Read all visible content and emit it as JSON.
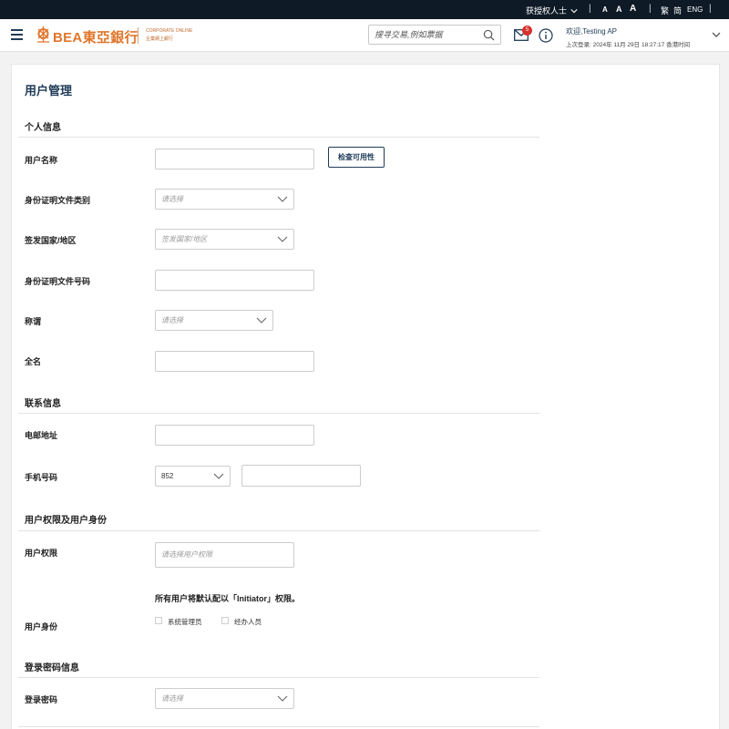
{
  "topbar": {
    "authorized_person": "获授权人士",
    "font_sizes": [
      "A",
      "A",
      "A"
    ],
    "lang_trad": "繁",
    "lang_simp": "简",
    "lang_eng": "ENG"
  },
  "header": {
    "logo_text": "BEA東亞銀行",
    "logo_sub_en": "CORPORATE ONLINE",
    "logo_sub_cn": "企業網上銀行",
    "search_placeholder": "搜寻交易,例如票据",
    "mail_badge": "5",
    "welcome": "欢迎,Testing AP",
    "last_login": "上次登录: 2024年 11月 29日 18:27:17 香港时间"
  },
  "page": {
    "title": "用户管理"
  },
  "personal": {
    "section_title": "个人信息",
    "username_label": "用户名称",
    "username_value": "",
    "check_button": "检查可用性",
    "id_type_label": "身份证明文件类别",
    "id_type_placeholder": "请选择",
    "issue_country_label": "签发国家/地区",
    "issue_country_placeholder": "签发国家/地区",
    "id_number_label": "身份证明文件号码",
    "id_number_value": "",
    "salutation_label": "称谓",
    "salutation_placeholder": "请选择",
    "fullname_label": "全名",
    "fullname_value": ""
  },
  "contact": {
    "section_title": "联系信息",
    "email_label": "电邮地址",
    "email_value": "",
    "mobile_label": "手机号码",
    "country_code": "852",
    "mobile_value": ""
  },
  "rights": {
    "section_title": "用户权限及用户身份",
    "rights_label": "用户权限",
    "rights_placeholder": "请选择用户权限",
    "note": "所有用户将默认配以「Initiator」权限。",
    "identity_label": "用户身份",
    "option_admin": "系统管理员",
    "option_operator": "经办人员"
  },
  "login": {
    "section_title": "登录密码信息",
    "password_label": "登录密码",
    "password_placeholder": "请选择"
  },
  "colors": {
    "navy": "#1f3b57",
    "brand_orange": "#e0762b",
    "topbar_bg": "#0e1a26",
    "badge_red": "#d7322d"
  },
  "icons": [
    "menu-icon",
    "bea-logo",
    "search-icon",
    "mail-icon",
    "info-icon",
    "chevron-down-icon"
  ]
}
